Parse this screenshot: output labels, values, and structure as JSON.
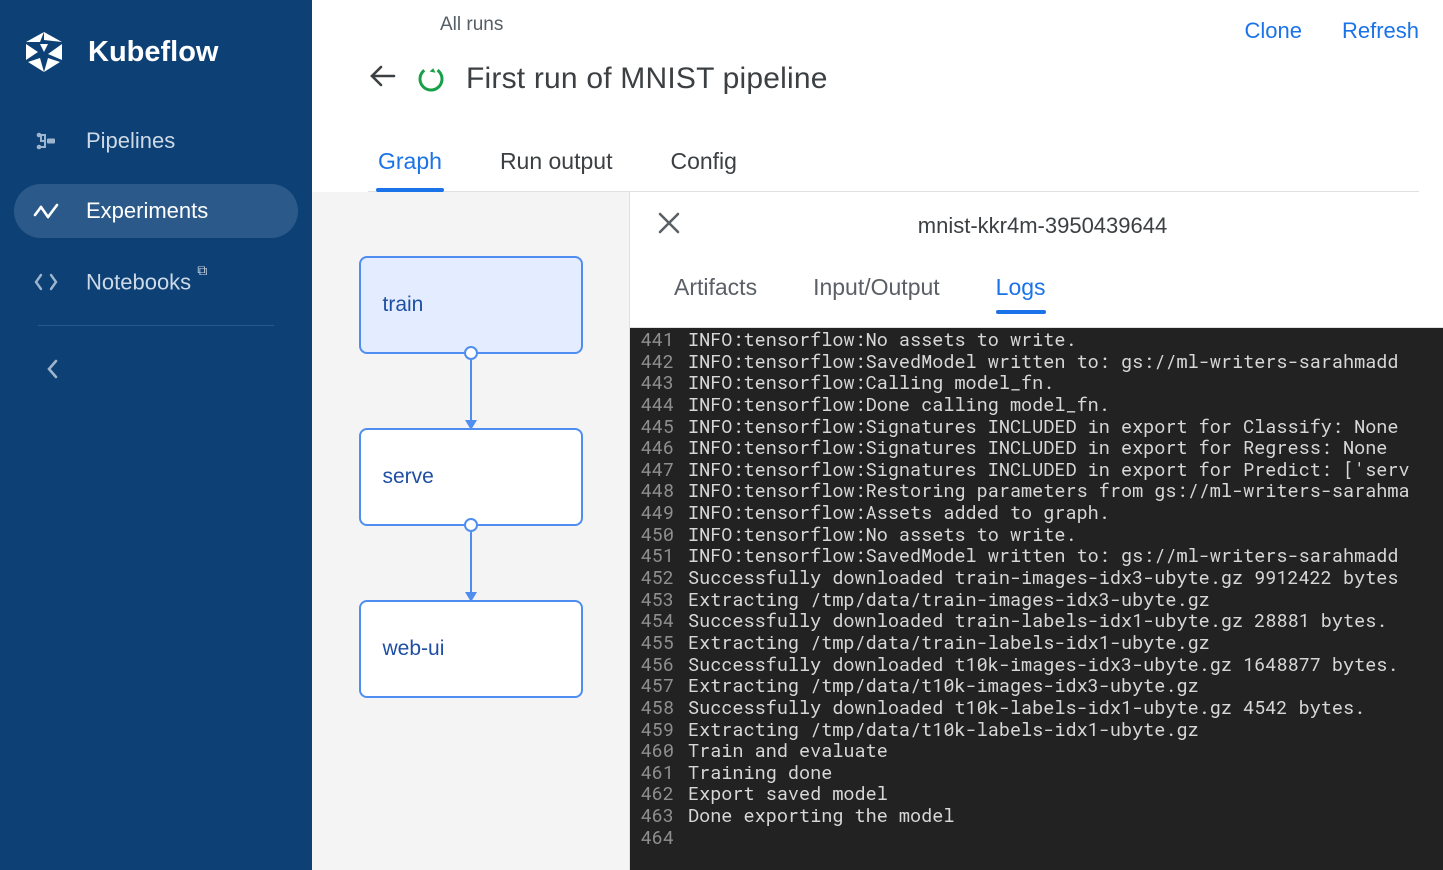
{
  "brand": {
    "name": "Kubeflow"
  },
  "sidebar": {
    "items": [
      {
        "label": "Pipelines",
        "active": false
      },
      {
        "label": "Experiments",
        "active": true
      },
      {
        "label": "Notebooks",
        "active": false,
        "external": true
      }
    ]
  },
  "header": {
    "breadcrumb": "All runs",
    "title": "First run of MNIST pipeline",
    "actions": {
      "clone": "Clone",
      "refresh": "Refresh"
    },
    "status": "success"
  },
  "tabs": [
    {
      "label": "Graph",
      "active": true
    },
    {
      "label": "Run output",
      "active": false
    },
    {
      "label": "Config",
      "active": false
    }
  ],
  "graph": {
    "nodes": [
      {
        "label": "train",
        "selected": true
      },
      {
        "label": "serve",
        "selected": false
      },
      {
        "label": "web-ui",
        "selected": false
      }
    ]
  },
  "panel": {
    "title": "mnist-kkr4m-3950439644",
    "tabs": [
      {
        "label": "Artifacts",
        "active": false
      },
      {
        "label": "Input/Output",
        "active": false
      },
      {
        "label": "Logs",
        "active": true
      }
    ]
  },
  "logs": [
    {
      "n": 441,
      "t": "INFO:tensorflow:No assets to write."
    },
    {
      "n": 442,
      "t": "INFO:tensorflow:SavedModel written to: gs://ml-writers-sarahmadd"
    },
    {
      "n": 443,
      "t": "INFO:tensorflow:Calling model_fn."
    },
    {
      "n": 444,
      "t": "INFO:tensorflow:Done calling model_fn."
    },
    {
      "n": 445,
      "t": "INFO:tensorflow:Signatures INCLUDED in export for Classify: None"
    },
    {
      "n": 446,
      "t": "INFO:tensorflow:Signatures INCLUDED in export for Regress: None"
    },
    {
      "n": 447,
      "t": "INFO:tensorflow:Signatures INCLUDED in export for Predict: ['serv"
    },
    {
      "n": 448,
      "t": "INFO:tensorflow:Restoring parameters from gs://ml-writers-sarahma"
    },
    {
      "n": 449,
      "t": "INFO:tensorflow:Assets added to graph."
    },
    {
      "n": 450,
      "t": "INFO:tensorflow:No assets to write."
    },
    {
      "n": 451,
      "t": "INFO:tensorflow:SavedModel written to: gs://ml-writers-sarahmadd"
    },
    {
      "n": 452,
      "t": "Successfully downloaded train-images-idx3-ubyte.gz 9912422 bytes"
    },
    {
      "n": 453,
      "t": "Extracting /tmp/data/train-images-idx3-ubyte.gz"
    },
    {
      "n": 454,
      "t": "Successfully downloaded train-labels-idx1-ubyte.gz 28881 bytes."
    },
    {
      "n": 455,
      "t": "Extracting /tmp/data/train-labels-idx1-ubyte.gz"
    },
    {
      "n": 456,
      "t": "Successfully downloaded t10k-images-idx3-ubyte.gz 1648877 bytes."
    },
    {
      "n": 457,
      "t": "Extracting /tmp/data/t10k-images-idx3-ubyte.gz"
    },
    {
      "n": 458,
      "t": "Successfully downloaded t10k-labels-idx1-ubyte.gz 4542 bytes."
    },
    {
      "n": 459,
      "t": "Extracting /tmp/data/t10k-labels-idx1-ubyte.gz"
    },
    {
      "n": 460,
      "t": "Train and evaluate"
    },
    {
      "n": 461,
      "t": "Training done"
    },
    {
      "n": 462,
      "t": "Export saved model"
    },
    {
      "n": 463,
      "t": "Done exporting the model"
    },
    {
      "n": 464,
      "t": ""
    }
  ],
  "colors": {
    "sidebar_bg": "#0d4075",
    "accent": "#1a73e8",
    "node_border": "#4f8ef0",
    "logs_bg": "#222222"
  }
}
